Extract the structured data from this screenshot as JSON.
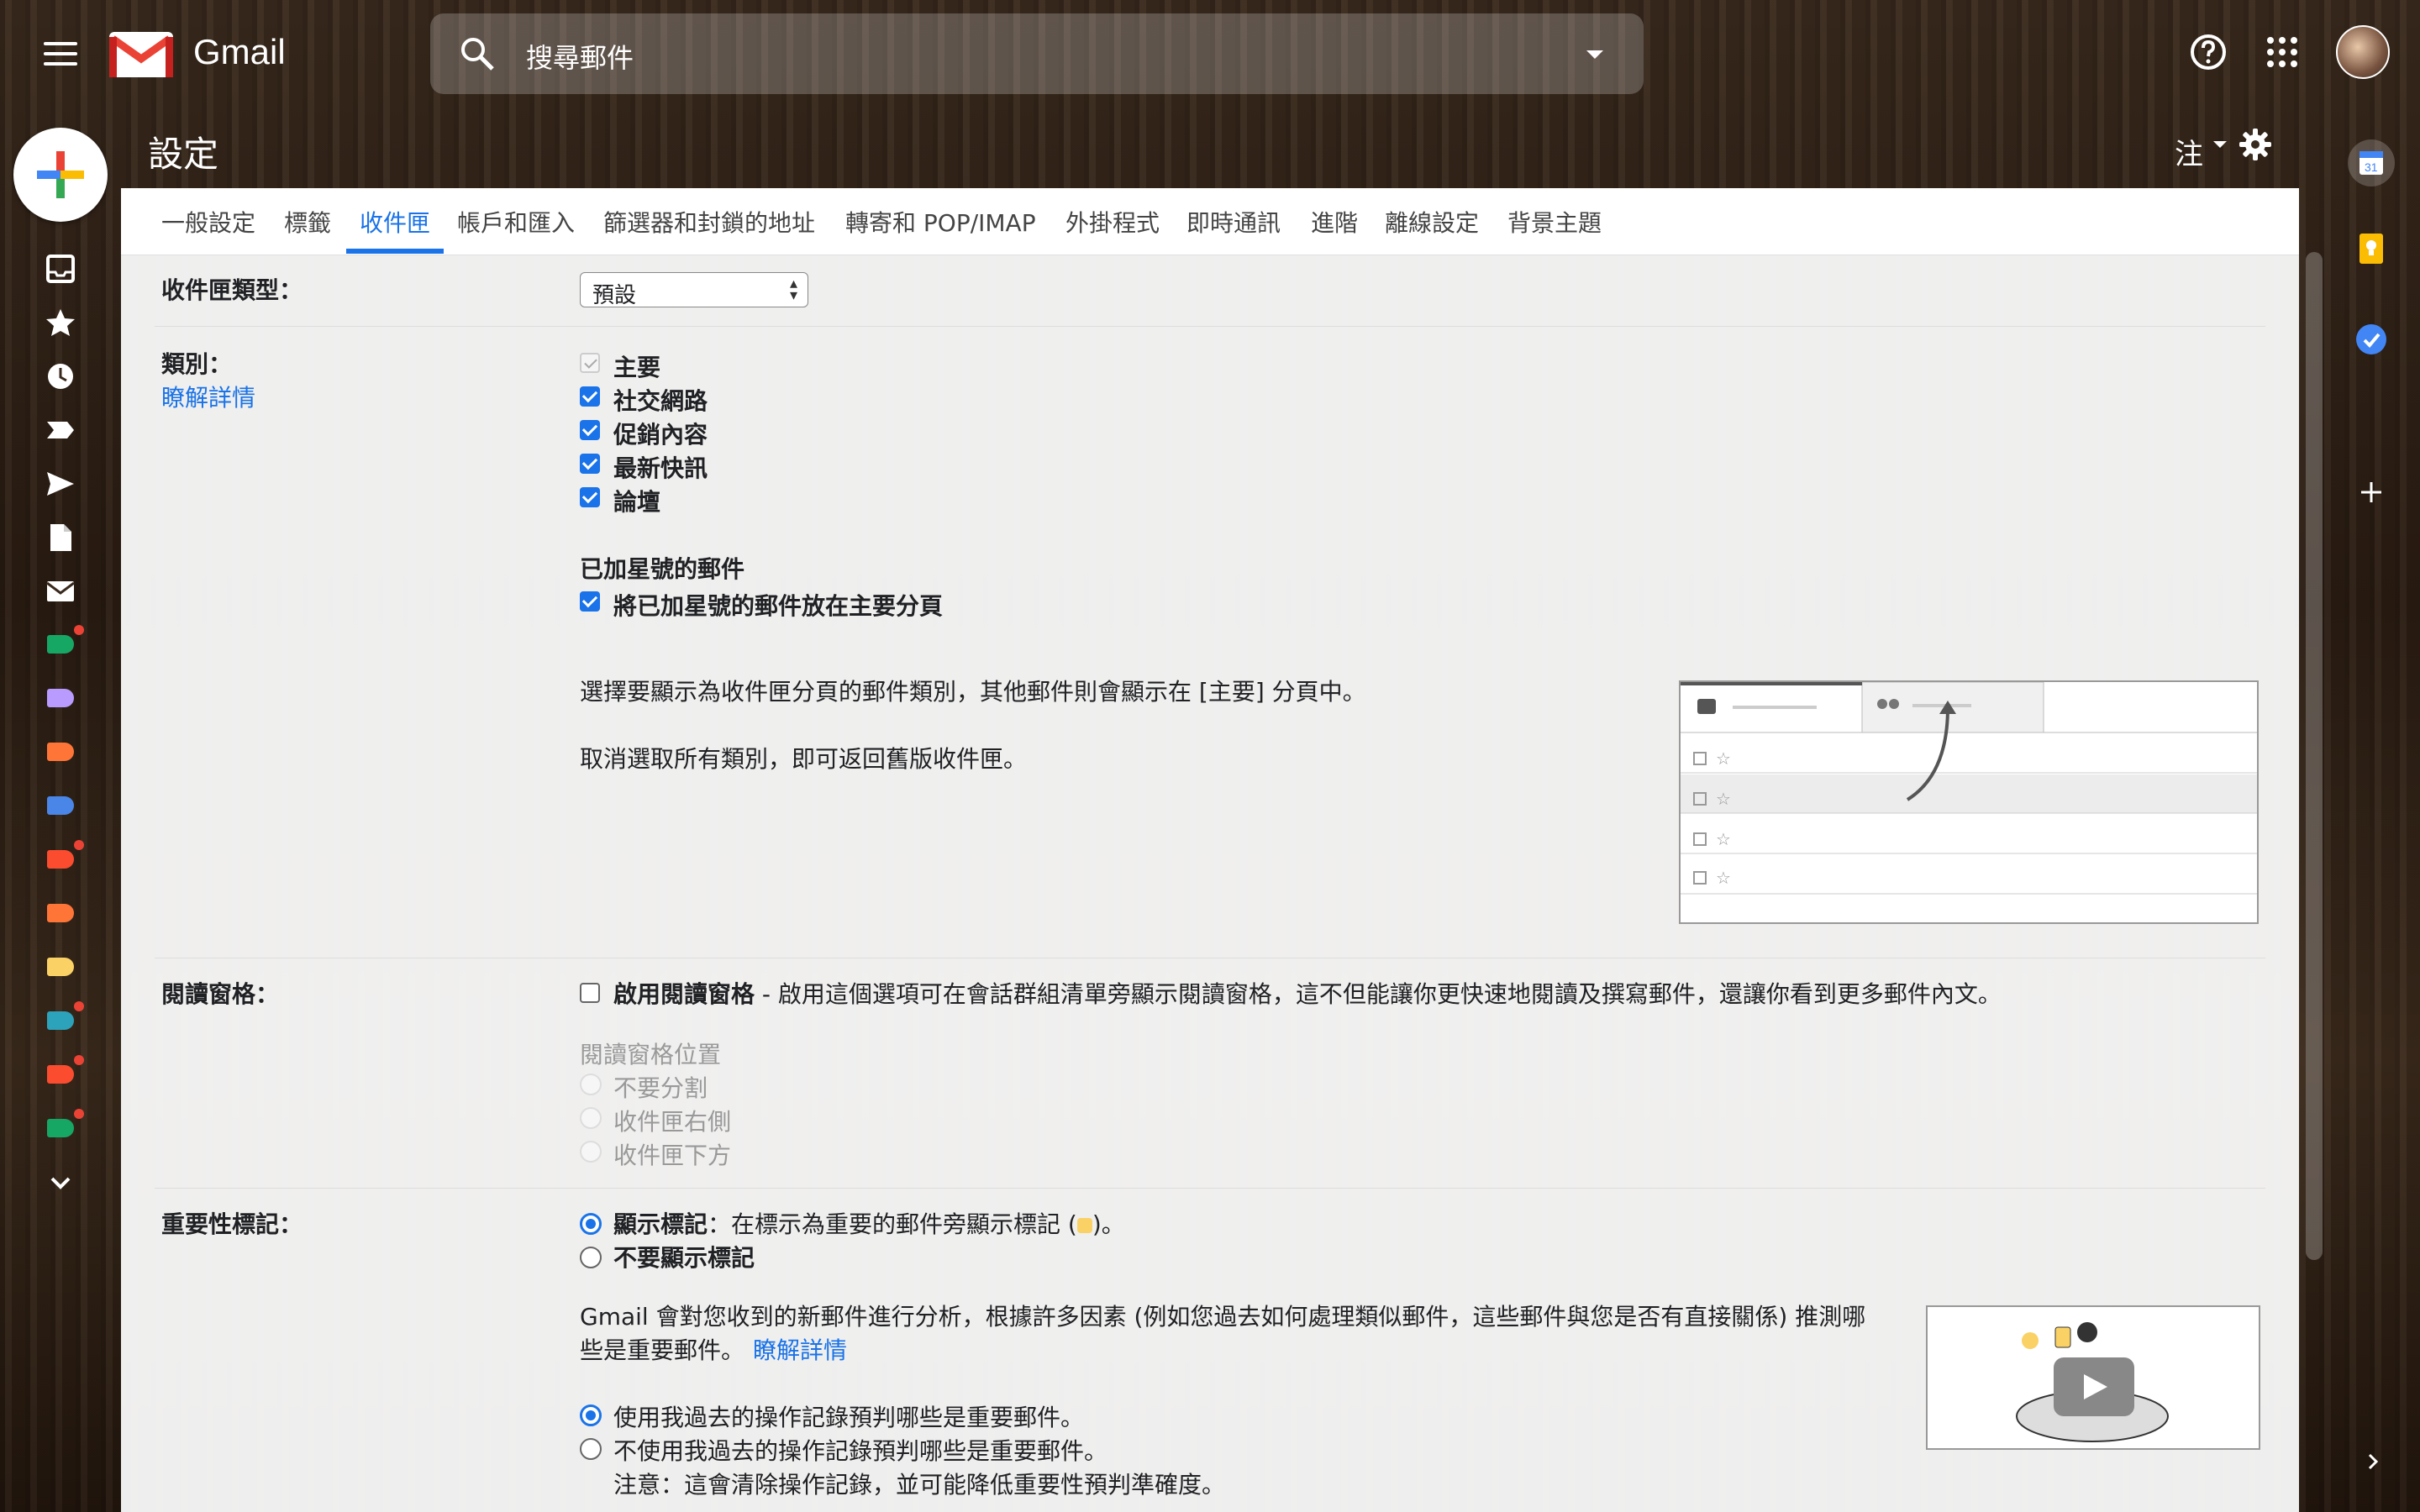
{
  "app": {
    "name": "Gmail"
  },
  "search": {
    "placeholder": "搜尋郵件"
  },
  "header": {
    "title": "設定",
    "lang": "注"
  },
  "tabs": [
    {
      "label": "一般設定"
    },
    {
      "label": "標籤"
    },
    {
      "label": "收件匣"
    },
    {
      "label": "帳戶和匯入"
    },
    {
      "label": "篩選器和封鎖的地址"
    },
    {
      "label": "轉寄和 POP/IMAP"
    },
    {
      "label": "外掛程式"
    },
    {
      "label": "即時通訊"
    },
    {
      "label": "進階"
    },
    {
      "label": "離線設定"
    },
    {
      "label": "背景主題"
    }
  ],
  "active_tab": "收件匣",
  "inbox_type": {
    "label": "收件匣類型：",
    "value": "預設"
  },
  "categories": {
    "label": "類別：",
    "learn_more": "瞭解詳情",
    "items": [
      {
        "label": "主要",
        "checked": true,
        "disabled": true
      },
      {
        "label": "社交網路",
        "checked": true
      },
      {
        "label": "促銷內容",
        "checked": true
      },
      {
        "label": "最新快訊",
        "checked": true
      },
      {
        "label": "論壇",
        "checked": true
      }
    ],
    "starred_heading": "已加星號的郵件",
    "starred_option": "將已加星號的郵件放在主要分頁",
    "help1": "選擇要顯示為收件匣分頁的郵件類別，其他郵件則會顯示在 [主要] 分頁中。",
    "help2": "取消選取所有類別，即可返回舊版收件匣。"
  },
  "reading_pane": {
    "label": "閱讀窗格：",
    "enable_label": "啟用閱讀窗格",
    "enable_desc": " - 啟用這個選項可在會話群組清單旁顯示閱讀窗格，這不但能讓你更快速地閱讀及撰寫郵件，還讓你看到更多郵件內文。",
    "position_heading": "閱讀窗格位置",
    "positions": [
      "不要分割",
      "收件匣右側",
      "收件匣下方"
    ]
  },
  "importance": {
    "label": "重要性標記：",
    "show_label": "顯示標記",
    "show_desc": "：在標示為重要的郵件旁顯示標記 (",
    "show_desc_end": ")。",
    "hide_label": "不要顯示標記",
    "explain_line1": "Gmail 會對您收到的新郵件進行分析，根據許多因素 (例如您過去如何處理類似郵件，這些郵件與您是否有直接關係) 推測哪",
    "explain_line2": "些是重要郵件。",
    "learn_more": "瞭解詳情",
    "use_history": "使用我過去的操作記錄預判哪些是重要郵件。",
    "no_history": "不使用我過去的操作記錄預判哪些是重要郵件。",
    "note": "注意：這會清除操作記錄，並可能降低重要性預判準確度。"
  },
  "colors": {
    "accent": "#1a73e8",
    "compose_red": "#ea4335",
    "compose_green": "#34a853",
    "compose_blue": "#4285f4",
    "compose_yellow": "#fbbc04"
  },
  "left_rail_icons": [
    "inbox-icon",
    "star-icon",
    "clock-icon",
    "label-important-icon",
    "send-icon",
    "draft-icon",
    "mail-icon"
  ],
  "right_rail_icons": [
    "calendar-icon",
    "keep-icon",
    "tasks-icon",
    "add-icon",
    "expand-icon"
  ]
}
